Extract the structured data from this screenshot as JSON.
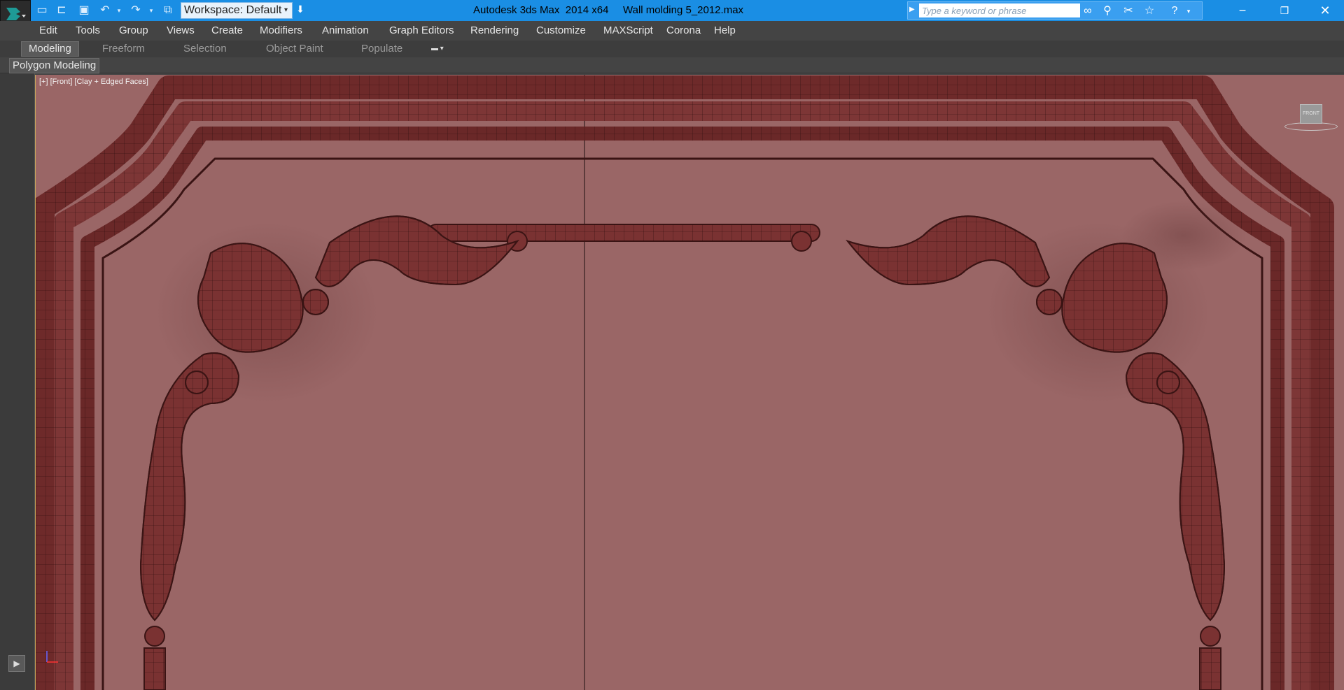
{
  "titlebar": {
    "app_name": "Autodesk 3ds Max  2014 x64",
    "file_name": "Wall molding 5_2012.max",
    "workspace_label": "Workspace: Default",
    "search_placeholder": "Type a keyword or phrase",
    "color": "#1a8ee4"
  },
  "quick_access": {
    "icons": [
      "new-file-icon",
      "open-file-icon",
      "save-icon",
      "undo-icon",
      "redo-icon",
      "project-folder-icon"
    ]
  },
  "menu": {
    "items": [
      "Edit",
      "Tools",
      "Group",
      "Views",
      "Create",
      "Modifiers",
      "Animation",
      "Graph Editors",
      "Rendering",
      "Customize",
      "MAXScript",
      "Corona",
      "Help"
    ]
  },
  "ribbon": {
    "tabs": [
      "Modeling",
      "Freeform",
      "Selection",
      "Object Paint",
      "Populate"
    ],
    "active_tab": "Modeling",
    "panel_label": "Polygon Modeling"
  },
  "viewport": {
    "label": "[+] [Front] [Clay + Edged Faces]",
    "viewcube_label": "FRONT",
    "background": "#9a6666",
    "molding_color": "#7a3232"
  }
}
